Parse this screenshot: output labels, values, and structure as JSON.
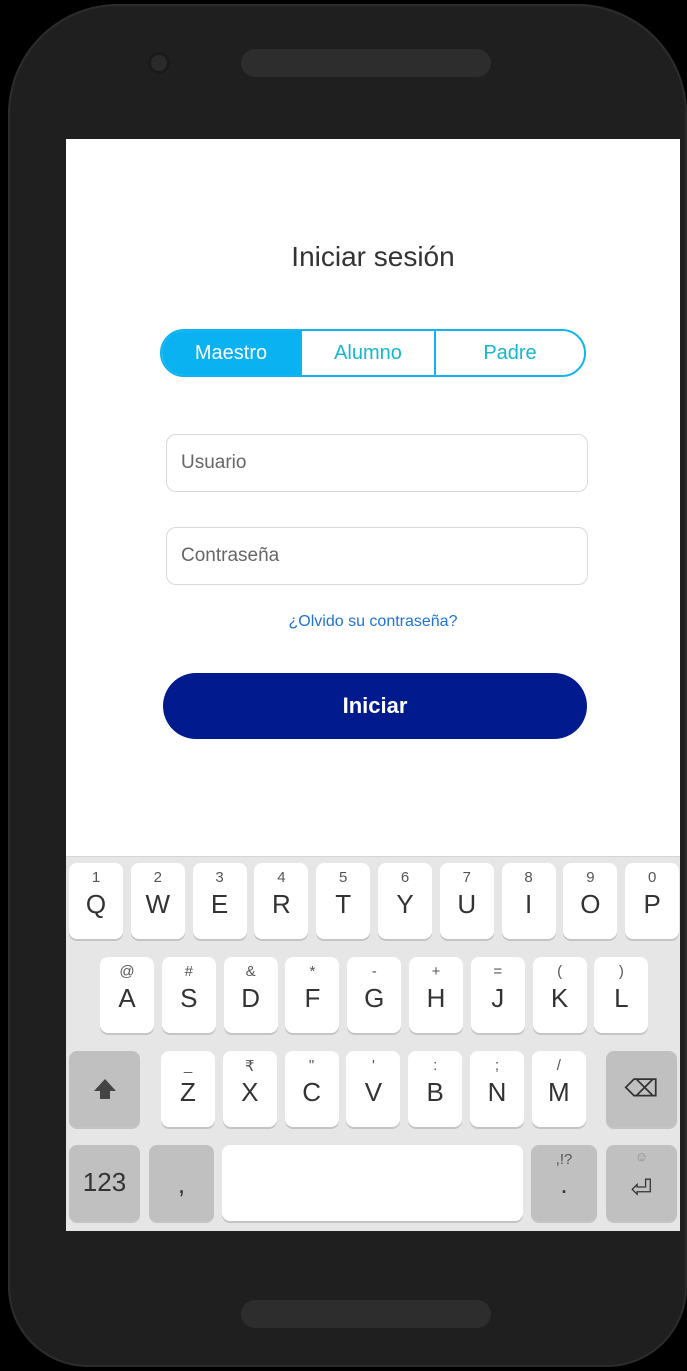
{
  "screen": {
    "title": "Iniciar sesión",
    "tabs": [
      {
        "label": "Maestro",
        "active": true
      },
      {
        "label": "Alumno",
        "active": false
      },
      {
        "label": "Padre",
        "active": false
      }
    ],
    "username_placeholder": "Usuario",
    "password_placeholder": "Contraseña",
    "forgot_link": "¿Olvido su contraseña?",
    "login_button": "Iniciar"
  },
  "colors": {
    "accent": "#0ab2f2",
    "button": "#011b8e",
    "link": "#1e73d8"
  },
  "keyboard": {
    "row1": [
      {
        "main": "Q",
        "sec": "1"
      },
      {
        "main": "W",
        "sec": "2"
      },
      {
        "main": "E",
        "sec": "3"
      },
      {
        "main": "R",
        "sec": "4"
      },
      {
        "main": "T",
        "sec": "5"
      },
      {
        "main": "Y",
        "sec": "6"
      },
      {
        "main": "U",
        "sec": "7"
      },
      {
        "main": "I",
        "sec": "8"
      },
      {
        "main": "O",
        "sec": "9"
      },
      {
        "main": "P",
        "sec": "0"
      }
    ],
    "row2": [
      {
        "main": "A",
        "sec": "@"
      },
      {
        "main": "S",
        "sec": "#"
      },
      {
        "main": "D",
        "sec": "&"
      },
      {
        "main": "F",
        "sec": "*"
      },
      {
        "main": "G",
        "sec": "-"
      },
      {
        "main": "H",
        "sec": "+"
      },
      {
        "main": "J",
        "sec": "="
      },
      {
        "main": "K",
        "sec": "("
      },
      {
        "main": "L",
        "sec": ")"
      }
    ],
    "row3": [
      {
        "main": "Z",
        "sec": "_"
      },
      {
        "main": "X",
        "sec": "₹"
      },
      {
        "main": "C",
        "sec": "\""
      },
      {
        "main": "V",
        "sec": "'"
      },
      {
        "main": "B",
        "sec": ":"
      },
      {
        "main": "N",
        "sec": ";"
      },
      {
        "main": "M",
        "sec": "/"
      }
    ],
    "numbers_key": "123",
    "comma_key": ",",
    "period_key": ".",
    "period_hint": ",!?",
    "shift_icon": "shift-icon",
    "backspace_icon": "backspace-icon",
    "enter_icon": "enter-icon",
    "emoji_icon": "emoji-icon"
  }
}
